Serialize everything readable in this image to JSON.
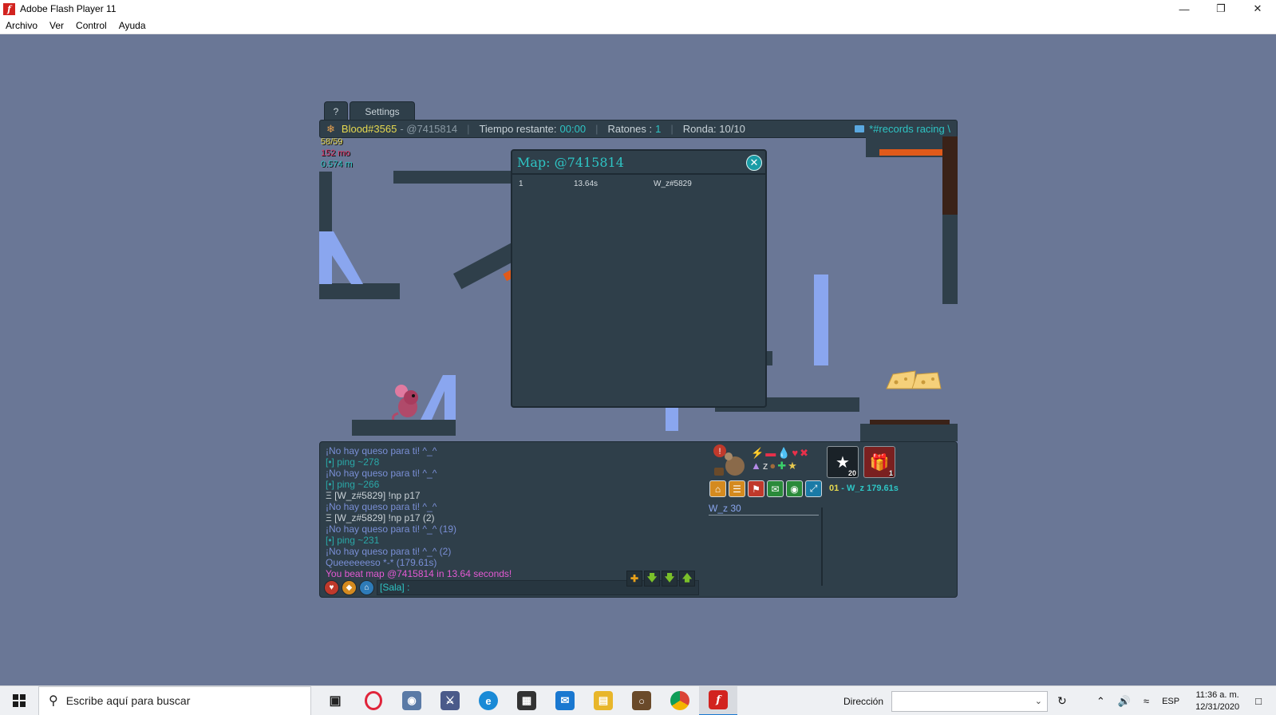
{
  "window": {
    "title": "Adobe Flash Player 11",
    "icon": "flash-player-icon",
    "controls": [
      "minimize-icon",
      "restore-icon",
      "close-icon"
    ]
  },
  "menu": [
    "Archivo",
    "Ver",
    "Control",
    "Ayuda"
  ],
  "game": {
    "tabs": {
      "help": "?",
      "settings": "Settings"
    },
    "hud": {
      "player": "Blood#3565",
      "map": "- @7415814",
      "time_label": "Tiempo restante:",
      "time_value": "00:00",
      "mice_label": "Ratones :",
      "mice_value": "1",
      "round": "Ronda: 10/10",
      "room": "*#records racing \\"
    },
    "stats": {
      "line1": "58/59",
      "line2": "152 mo",
      "line3": "0.574 m"
    },
    "map_dialog": {
      "title": "Map: @7415814",
      "rows": [
        {
          "rank": "1",
          "time": "13.64s",
          "player": "W_z#5829"
        }
      ]
    },
    "chat": [
      {
        "text": "¡No hay queso para ti! ^_^",
        "color": "#7a8fd6"
      },
      {
        "text": "[•] ping ~278",
        "color": "#2aa8a8"
      },
      {
        "text": "¡No hay queso para ti! ^_^",
        "color": "#7a8fd6"
      },
      {
        "text": "[•] ping ~266",
        "color": "#2aa8a8"
      },
      {
        "text": "Ξ [W_z#5829] !np p17",
        "color": "#c9d1d6"
      },
      {
        "text": "¡No hay queso para ti! ^_^",
        "color": "#7a8fd6"
      },
      {
        "text": "Ξ [W_z#5829] !np p17 (2)",
        "color": "#c9d1d6"
      },
      {
        "text": "¡No hay queso para ti! ^_^ (19)",
        "color": "#7a8fd6"
      },
      {
        "text": "[•] ping ~231",
        "color": "#2aa8a8"
      },
      {
        "text": "¡No hay queso para ti! ^_^ (2)",
        "color": "#7a8fd6"
      },
      {
        "text": "Queeeeeeso *-* (179.61s)",
        "color": "#7a8fd6"
      },
      {
        "text": "You beat map @7415814 in 13.64 seconds!",
        "color": "#e35ad3"
      }
    ],
    "chat_input": "[Sala] :",
    "leaderboard_entry": {
      "rank": "01",
      "name": "W_z",
      "time": "179.61s"
    },
    "player_score": "W_z 30",
    "badge_counts": {
      "shaman": "20",
      "gift": "1"
    }
  },
  "taskbar": {
    "search_placeholder": "Escribe aquí para buscar",
    "address_label": "Dirección",
    "language": "ESP",
    "time": "11:36 a. m.",
    "date": "12/31/2020"
  }
}
